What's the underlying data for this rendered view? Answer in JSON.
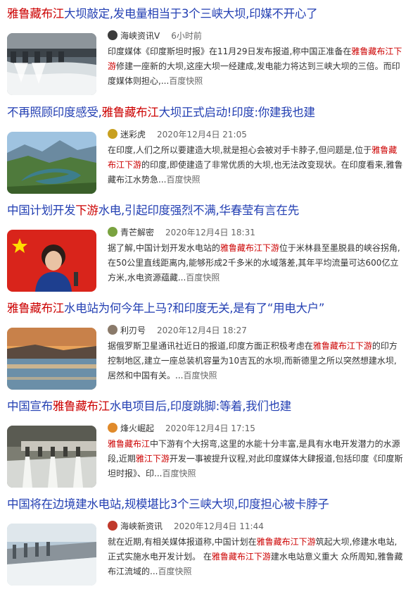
{
  "results": [
    {
      "title": {
        "hl1": "雅鲁藏布江",
        "rest": "大坝敲定,发电量相当于3个三峡大坝,印媒不开心了"
      },
      "source": {
        "name": "海峡资讯V",
        "date": "6小时前"
      },
      "abstract": {
        "p1": "印度媒体《印度斯坦时报》在11月29日发布报道,称中国正准备在",
        "hl": "雅鲁藏布江下游",
        "p2": "修建一座新的大坝,这座大坝一经建成,发电能力将达到三峡大坝的三倍。而印度媒体则担心,...",
        "quick": "百度快照"
      }
    },
    {
      "title": {
        "pre": "不再照顾印度感受,",
        "hl1": "雅鲁藏布江",
        "rest": "大坝正式启动!印度:你建我也建"
      },
      "source": {
        "name": "迷彩虎",
        "date": "2020年12月4日 21:05"
      },
      "abstract": {
        "p1": "在印度,人们之所以要建造大坝,就是担心会被对手卡脖子,但问题是,位于",
        "hl": "雅鲁藏布江下游",
        "p2": "的印度,即使建造了非常优质的大坝,也无法改变现状。在印度看来,雅鲁藏布江水势急...",
        "quick": "百度快照"
      }
    },
    {
      "title": {
        "pre": "中国计划开发",
        "hl1": "下游",
        "rest": "水电,引起印度强烈不满,华春莹有言在先"
      },
      "source": {
        "name": "青芒解密",
        "date": "2020年12月4日 18:31"
      },
      "abstract": {
        "p1": "据了解,中国计划开发水电站的",
        "hl": "雅鲁藏布江下游",
        "p2": "位于米林县至墨脱县的峡谷拐角,在50公里直线距离内,能够形成2千多米的水域落差,其年平均流量可达600亿立方米,水电资源蕴藏...",
        "quick": "百度快照"
      }
    },
    {
      "title": {
        "hl1": "雅鲁藏布江",
        "rest": "水电站为何今年上马?和印度无关,是有了“用电大户”"
      },
      "source": {
        "name": "利刃号",
        "date": "2020年12月4日 18:27"
      },
      "abstract": {
        "p1": "据俄罗斯卫星通讯社近日的报道,印度方面正积极考虑在",
        "hl": "雅鲁藏布江下游",
        "p2": "的印方控制地区,建立一座总装机容量为10吉瓦的水坝,而新德里之所以突然想建水坝,居然和中国有关。...",
        "quick": "百度快照"
      }
    },
    {
      "title": {
        "pre": "中国宣布",
        "hl1": "雅鲁藏布江",
        "rest": "水电项目后,印度跳脚:等着,我们也建"
      },
      "source": {
        "name": "烽火崛起",
        "date": "2020年12月4日 17:15"
      },
      "abstract": {
        "hl0": "雅鲁藏布江",
        "p1": "中下游有个大拐弯,这里的水能十分丰富,是具有水电开发潜力的水源段,近期",
        "hl": "雅江下游",
        "p2": "开发一事被提升议程,对此印度媒体大肆报道,包括印度《印度斯坦时报》、印...",
        "quick": "百度快照"
      }
    },
    {
      "title": {
        "pre": "中国将在边境建水电站,规模堪比3个三峡大坝,印度担心被卡脖子"
      },
      "source": {
        "name": "海峡新资讯",
        "date": "2020年12月4日 11:44"
      },
      "abstract": {
        "p1": "就在近期,有相关媒体报道称,中国计划在",
        "hl": "雅鲁藏布江下游",
        "p2": "筑起大坝,修建水电站,正式实施水电开发计划。 在",
        "hl2": "雅鲁藏布江下游",
        "p3": "建水电站意义重大 众所周知,雅鲁藏布江流域的...",
        "quick": "百度快照"
      }
    }
  ],
  "colors": {
    "link": "#2440b3",
    "highlight": "#cc0000"
  }
}
